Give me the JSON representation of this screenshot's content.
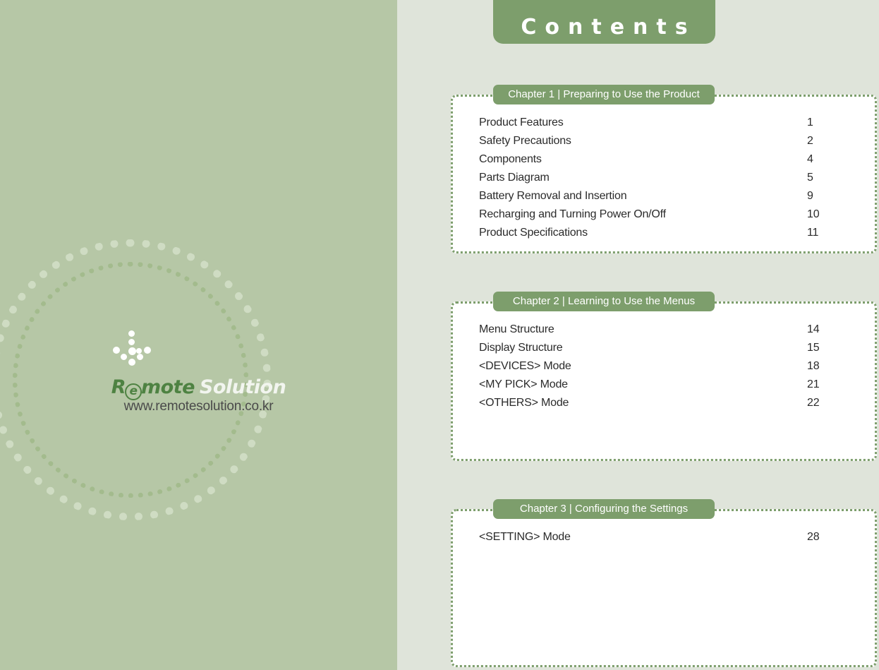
{
  "page": {
    "banner_title": "Contents",
    "colors": {
      "left_page_bg": "#b6c7a6",
      "right_page_bg": "#dfe4da",
      "accent_green": "#7d9e6c",
      "panel_bg": "#ffffff",
      "text": "#2b2b2b",
      "logo_green": "#4e8242"
    }
  },
  "brand": {
    "wordmark_part1": "R",
    "wordmark_circled_letter": "e",
    "wordmark_part2": "mote",
    "wordmark_part3": "Solution",
    "url": "www.remotesolution.co.kr"
  },
  "chapters": [
    {
      "tab_label": "Chapter 1 | Preparing to Use the Product",
      "entries": [
        {
          "title": "Product Features",
          "page": "1"
        },
        {
          "title": "Safety Precautions",
          "page": "2"
        },
        {
          "title": "Components",
          "page": "4"
        },
        {
          "title": "Parts Diagram",
          "page": "5"
        },
        {
          "title": "Battery Removal and Insertion",
          "page": "9"
        },
        {
          "title": "Recharging and Turning Power On/Off",
          "page": "10"
        },
        {
          "title": "Product Specifications",
          "page": "11"
        }
      ]
    },
    {
      "tab_label": "Chapter 2 | Learning to Use the Menus",
      "entries": [
        {
          "title": "Menu Structure",
          "page": "14"
        },
        {
          "title": "Display Structure",
          "page": "15"
        },
        {
          "title": "<DEVICES> Mode",
          "page": "18"
        },
        {
          "title": "<MY PICK> Mode",
          "page": "21"
        },
        {
          "title": "<OTHERS> Mode",
          "page": "22"
        }
      ]
    },
    {
      "tab_label": "Chapter 3 | Configuring the Settings",
      "entries": [
        {
          "title": "<SETTING> Mode",
          "page": "28"
        }
      ]
    }
  ]
}
